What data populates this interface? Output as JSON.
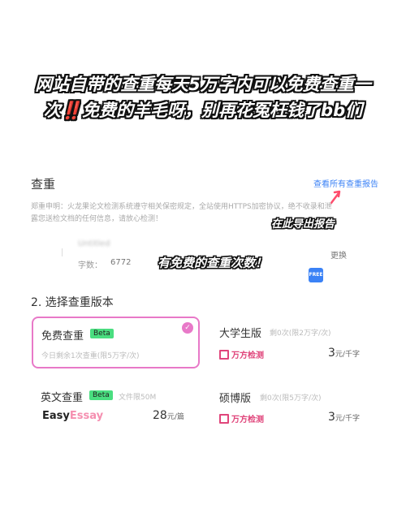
{
  "headline": {
    "line1": "网站自带的查重每天5万字内可以免费查重一",
    "line2": "次‼️免费的羊毛呀，别再花冤枉钱了bb们"
  },
  "card": {
    "title": "查重",
    "report_link": "查看所有查重报告",
    "notice_line1": "郑重申明：火龙果论文检测系统遵守相关保密规定，全站使用HTTPS加密协议，绝不收录和泄",
    "notice_line2": "露您送检文档的任何信息，请放心检测！"
  },
  "annotations": {
    "export": "在此导出报告",
    "free_count": "有免费的查重次数！"
  },
  "document": {
    "name": "Untitled",
    "word_count_label": "字数：",
    "word_count": "6772",
    "change_label": "更换",
    "free_badge": "FREE"
  },
  "section": {
    "title": "2. 选择查重版本"
  },
  "options": {
    "free": {
      "name": "免费查重",
      "badge": "Beta",
      "sub": "今日剩余1次查重(限5万字/次)"
    },
    "undergrad": {
      "name": "大学生版",
      "sub": "剩0次(限2万字/次)",
      "brand": "万方检测",
      "price": "3",
      "unit": "元/千字"
    },
    "english": {
      "name": "英文查重",
      "badge": "Beta",
      "sub": "文件限50M",
      "brand_a": "Easy",
      "brand_b": "Essay",
      "price": "28",
      "unit": "元/篇"
    },
    "master": {
      "name": "硕博版",
      "sub": "剩0次(限5万字/次)",
      "brand": "万方检测",
      "price": "3",
      "unit": "元/千字"
    }
  },
  "colors": {
    "accent_pink": "#e879c8",
    "link_blue": "#3b82f6",
    "beta_green": "#4ade80",
    "brand_red": "#e0457b"
  }
}
